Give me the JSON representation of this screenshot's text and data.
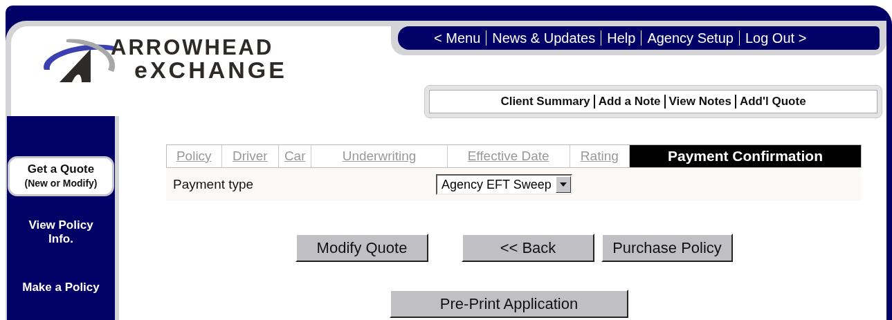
{
  "logo": {
    "line_1": "ARROWHEAD",
    "line_2": "eXCHANGE"
  },
  "top_nav": [
    {
      "label": "< Menu"
    },
    {
      "label": "News & Updates"
    },
    {
      "label": "Help"
    },
    {
      "label": "Agency Setup"
    },
    {
      "label": "Log Out >"
    }
  ],
  "client_nav": [
    {
      "label": "Client Summary"
    },
    {
      "label": "Add a Note"
    },
    {
      "label": "View Notes"
    },
    {
      "label": "Add'l Quote"
    }
  ],
  "sidebar": {
    "items": [
      {
        "label": "Get a Quote",
        "sublabel": "(New or Modify)",
        "selected": true
      },
      {
        "label": "View Policy Info.",
        "selected": false
      },
      {
        "label": "Make a Policy",
        "selected": false
      }
    ]
  },
  "tabs": [
    {
      "label": "Policy",
      "selected": false
    },
    {
      "label": "Driver",
      "selected": false
    },
    {
      "label": "Car",
      "selected": false
    },
    {
      "label": "Underwriting",
      "selected": false
    },
    {
      "label": "Effective Date",
      "selected": false
    },
    {
      "label": "Rating",
      "selected": false
    },
    {
      "label": "Payment Confirmation",
      "selected": true
    }
  ],
  "payment_type": {
    "label": "Payment type",
    "value": "Agency EFT Sweep"
  },
  "buttons": [
    {
      "label": "Modify Quote"
    },
    {
      "label": "<< Back"
    },
    {
      "label": "Purchase Policy"
    }
  ],
  "print_button": {
    "label": "Pre-Print Application"
  }
}
